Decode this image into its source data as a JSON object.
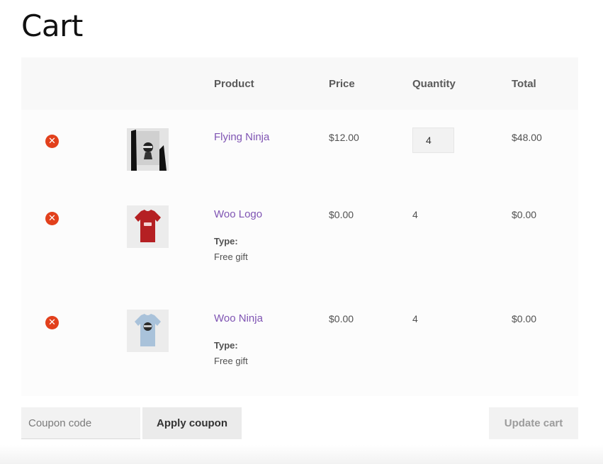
{
  "page": {
    "title": "Cart"
  },
  "table": {
    "headers": {
      "product": "Product",
      "price": "Price",
      "quantity": "Quantity",
      "total": "Total"
    },
    "rows": [
      {
        "name": "Flying Ninja",
        "price": "$12.00",
        "quantity": "4",
        "total": "$48.00",
        "quantity_editable": true,
        "meta": null,
        "thumb": "poster"
      },
      {
        "name": "Woo Logo",
        "price": "$0.00",
        "quantity": "4",
        "total": "$0.00",
        "quantity_editable": false,
        "meta": {
          "label": "Type:",
          "value": "Free gift"
        },
        "thumb": "red-tshirt"
      },
      {
        "name": "Woo Ninja",
        "price": "$0.00",
        "quantity": "4",
        "total": "$0.00",
        "quantity_editable": false,
        "meta": {
          "label": "Type:",
          "value": "Free gift"
        },
        "thumb": "blue-tshirt"
      }
    ]
  },
  "actions": {
    "coupon_placeholder": "Coupon code",
    "apply_label": "Apply coupon",
    "update_label": "Update cart"
  },
  "colors": {
    "link": "#7f54b3",
    "remove": "#e2401c"
  }
}
